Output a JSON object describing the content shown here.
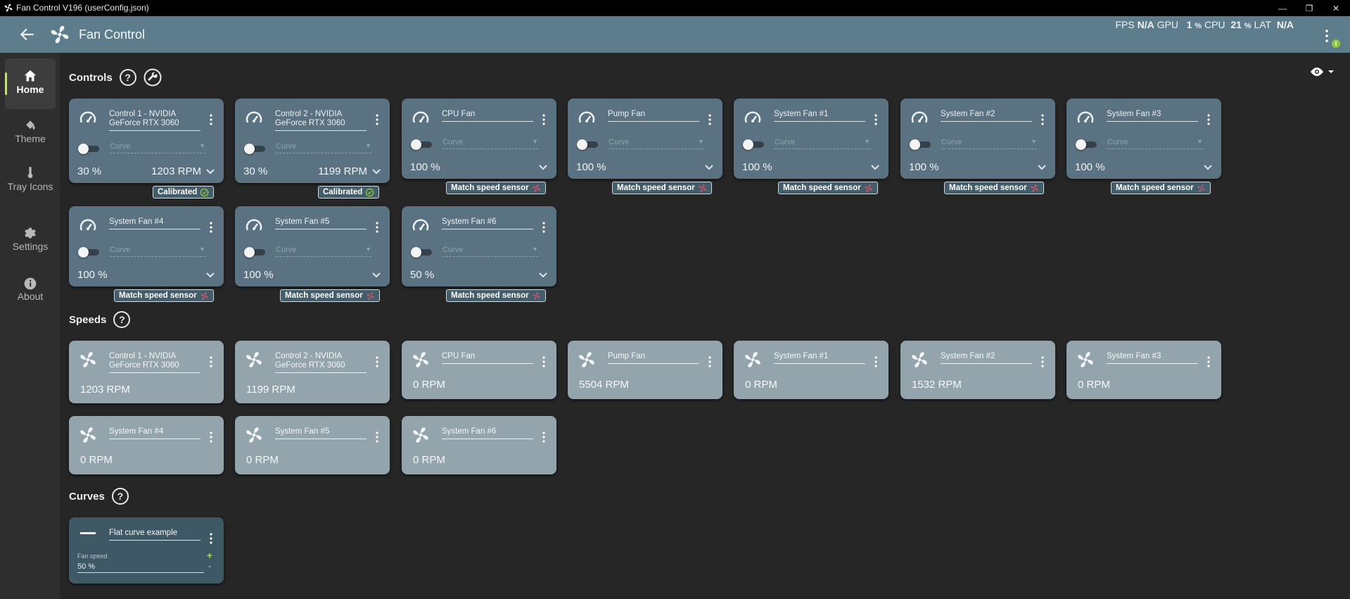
{
  "window": {
    "title": "Fan Control V196 (userConfig.json)",
    "minimize": "—",
    "maximize": "❐",
    "close": "✕"
  },
  "header": {
    "title": "Fan Control",
    "stats": {
      "fps_label": "FPS",
      "fps_value": "N/A",
      "gpu_label": "GPU",
      "gpu_value": "1",
      "gpu_unit": "%",
      "cpu_label": "CPU",
      "cpu_value": "21",
      "cpu_unit": "%",
      "lat_label": "LAT",
      "lat_value": "N/A"
    },
    "notification": "i"
  },
  "sidebar": {
    "items": [
      {
        "label": "Home",
        "icon": "home-icon"
      },
      {
        "label": "Theme",
        "icon": "paint-bucket-icon"
      },
      {
        "label": "Tray Icons",
        "icon": "thermometer-icon"
      },
      {
        "label": "Settings",
        "icon": "gear-icon"
      },
      {
        "label": "About",
        "icon": "info-icon"
      }
    ]
  },
  "sections": {
    "controls": "Controls",
    "speeds": "Speeds",
    "curves": "Curves",
    "help": "?"
  },
  "controls": [
    {
      "name": "Control 1 - NVIDIA GeForce RTX 3060",
      "curve": "Curve",
      "percent": "30 %",
      "rpm": "1203 RPM",
      "badge": "Calibrated"
    },
    {
      "name": "Control 2 - NVIDIA GeForce RTX 3060",
      "curve": "Curve",
      "percent": "30 %",
      "rpm": "1199 RPM",
      "badge": "Calibrated"
    },
    {
      "name": "CPU Fan",
      "curve": "Curve",
      "percent": "100 %",
      "badge": "Match speed sensor"
    },
    {
      "name": "Pump Fan",
      "curve": "Curve",
      "percent": "100 %",
      "badge": "Match speed sensor"
    },
    {
      "name": "System Fan #1",
      "curve": "Curve",
      "percent": "100 %",
      "badge": "Match speed sensor"
    },
    {
      "name": "System Fan #2",
      "curve": "Curve",
      "percent": "100 %",
      "badge": "Match speed sensor"
    },
    {
      "name": "System Fan #3",
      "curve": "Curve",
      "percent": "100 %",
      "badge": "Match speed sensor"
    },
    {
      "name": "System Fan #4",
      "curve": "Curve",
      "percent": "100 %",
      "badge": "Match speed sensor"
    },
    {
      "name": "System Fan #5",
      "curve": "Curve",
      "percent": "100 %",
      "badge": "Match speed sensor"
    },
    {
      "name": "System Fan #6",
      "curve": "Curve",
      "percent": "50 %",
      "badge": "Match speed sensor"
    }
  ],
  "speeds": [
    {
      "name": "Control 1 - NVIDIA GeForce RTX 3060",
      "rpm": "1203 RPM"
    },
    {
      "name": "Control 2 - NVIDIA GeForce RTX 3060",
      "rpm": "1199 RPM"
    },
    {
      "name": "CPU Fan",
      "rpm": "0 RPM"
    },
    {
      "name": "Pump Fan",
      "rpm": "5504 RPM"
    },
    {
      "name": "System Fan #1",
      "rpm": "0 RPM"
    },
    {
      "name": "System Fan #2",
      "rpm": "1532 RPM"
    },
    {
      "name": "System Fan #3",
      "rpm": "0 RPM"
    },
    {
      "name": "System Fan #4",
      "rpm": "0 RPM"
    },
    {
      "name": "System Fan #5",
      "rpm": "0 RPM"
    },
    {
      "name": "System Fan #6",
      "rpm": "0 RPM"
    }
  ],
  "curves": [
    {
      "name": "Flat curve example",
      "field_label": "Fan speed",
      "value": "50 %",
      "add": "+",
      "remove": "-"
    }
  ],
  "colors": {
    "accent": "#c5e84a",
    "header": "#5e7d8c",
    "control_card": "#5a7281",
    "speed_card": "#93a4ad",
    "curve_card": "#3f5866",
    "badge_icon_red": "#e0506a",
    "badge_icon_green": "#8dc63f"
  }
}
